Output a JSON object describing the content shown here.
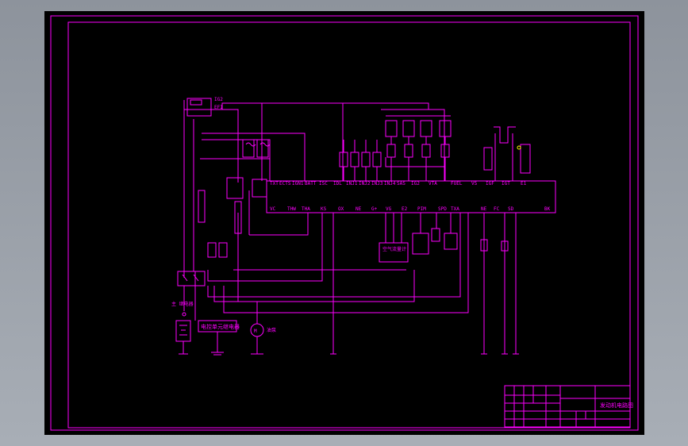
{
  "drawing": {
    "labels": {
      "air_meter": "空气流量计",
      "ecu_relay": "电控单元继电器",
      "title_block_name": "发动机电路图",
      "title_block_school": "",
      "title_block_code": ""
    }
  },
  "colors": {
    "background": "#000000",
    "lines": "#ff00ff",
    "accents": "#ffff00",
    "white_lines": "#e8e8e8",
    "viewport": "#9aa0a9"
  }
}
